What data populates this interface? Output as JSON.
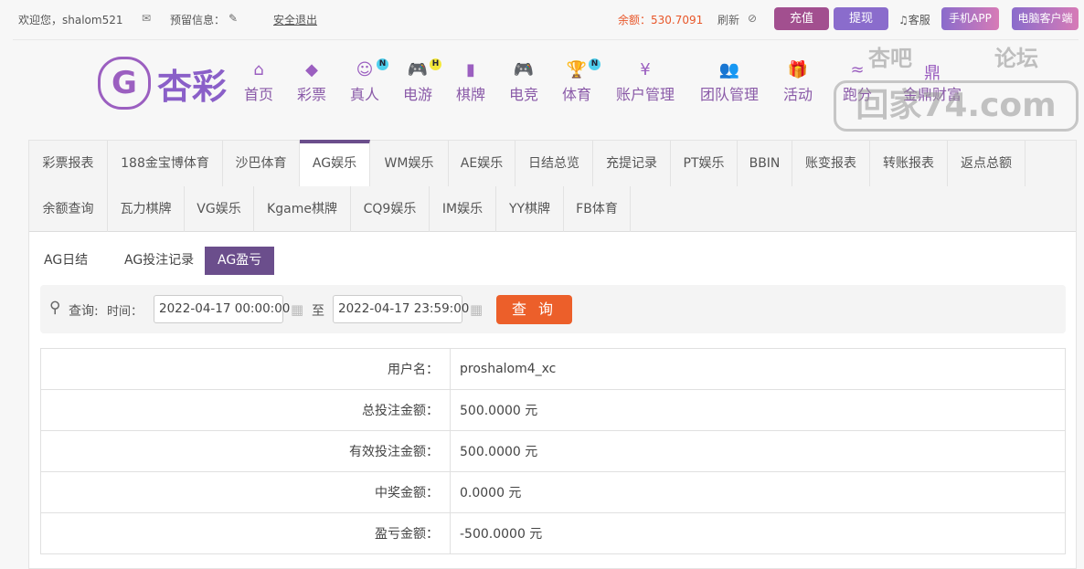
{
  "top": {
    "welcome": "欢迎您，shalom521",
    "message_label": "预留信息：",
    "logout": "安全退出",
    "balance": "余额：530.7091",
    "refresh": "刷新",
    "recharge": "充值",
    "withdraw": "提现",
    "service": "客服",
    "mobile_app": "手机APP",
    "pc_client": "电脑客户端"
  },
  "logo": "杏彩",
  "nav": [
    {
      "label": "首页",
      "icon": "⌂"
    },
    {
      "label": "彩票",
      "icon": "◆"
    },
    {
      "label": "真人",
      "icon": "☺",
      "badge": "N"
    },
    {
      "label": "电游",
      "icon": "🎮",
      "badge": "H"
    },
    {
      "label": "棋牌",
      "icon": "▮"
    },
    {
      "label": "电竞",
      "icon": "🎮"
    },
    {
      "label": "体育",
      "icon": "🏆",
      "badge": "N"
    },
    {
      "label": "账户管理",
      "icon": "¥"
    },
    {
      "label": "团队管理",
      "icon": "👥"
    },
    {
      "label": "活动",
      "icon": "🎁"
    },
    {
      "label": "跑分",
      "icon": "≈"
    },
    {
      "label": "金鼎财富",
      "icon": "鼎"
    }
  ],
  "tabs_row1": [
    "彩票报表",
    "188金宝博体育",
    "沙巴体育",
    "AG娱乐",
    "WM娱乐",
    "AE娱乐",
    "日结总览",
    "充提记录",
    "PT娱乐",
    "BBIN",
    "账变报表",
    "转账报表",
    "返点总额"
  ],
  "tabs_row2": [
    "余额查询",
    "瓦力棋牌",
    "VG娱乐",
    "Kgame棋牌",
    "CQ9娱乐",
    "IM娱乐",
    "YY棋牌",
    "FB体育"
  ],
  "subtabs": [
    "AG日结",
    "AG投注记录",
    "AG盈亏"
  ],
  "search": {
    "label": "查询:",
    "time_label": "时间：",
    "start": "2022-04-17 00:00:00",
    "to": "至",
    "end": "2022-04-17 23:59:00",
    "button": "查 询"
  },
  "rows": [
    {
      "label": "用户名：",
      "value": "proshalom4_xc"
    },
    {
      "label": "总投注金额：",
      "value": "500.0000 元"
    },
    {
      "label": "有效投注金额：",
      "value": "500.0000 元"
    },
    {
      "label": "中奖金额：",
      "value": "0.0000 元"
    },
    {
      "label": "盈亏金额：",
      "value": "-500.0000 元"
    }
  ],
  "watermark": {
    "line1": "杏吧",
    "line2": "论坛",
    "line3": "回家74.com"
  }
}
